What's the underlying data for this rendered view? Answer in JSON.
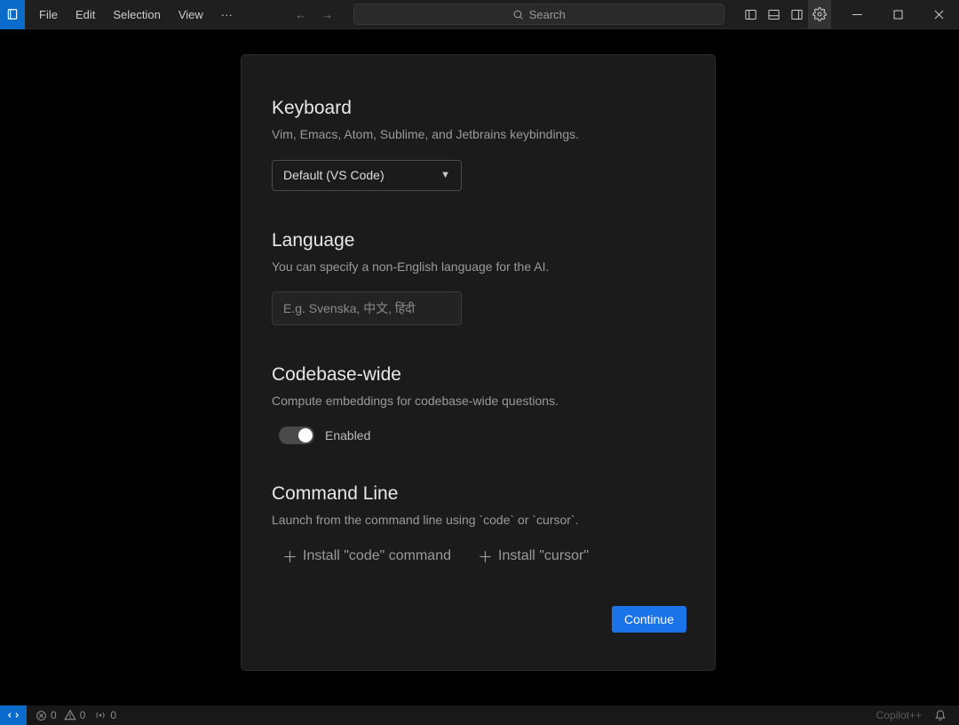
{
  "titlebar": {
    "menus": [
      "File",
      "Edit",
      "Selection",
      "View"
    ],
    "ellipsis": "···",
    "search_placeholder": "Search"
  },
  "sections": {
    "keyboard": {
      "title": "Keyboard",
      "desc": "Vim, Emacs, Atom, Sublime, and Jetbrains keybindings.",
      "selected": "Default (VS Code)"
    },
    "language": {
      "title": "Language",
      "desc": "You can specify a non-English language for the AI.",
      "placeholder": "E.g. Svenska, 中文, हिंदी"
    },
    "codebase": {
      "title": "Codebase-wide",
      "desc": "Compute embeddings for codebase-wide questions.",
      "toggle_label": "Enabled"
    },
    "cmdline": {
      "title": "Command Line",
      "desc": "Launch from the command line using `code` or `cursor`.",
      "install_code": "Install \"code\" command",
      "install_cursor": "Install \"cursor\""
    }
  },
  "footer": {
    "continue": "Continue"
  },
  "status": {
    "errors": "0",
    "warnings": "0",
    "ports": "0",
    "copilot": "Copilot++"
  }
}
